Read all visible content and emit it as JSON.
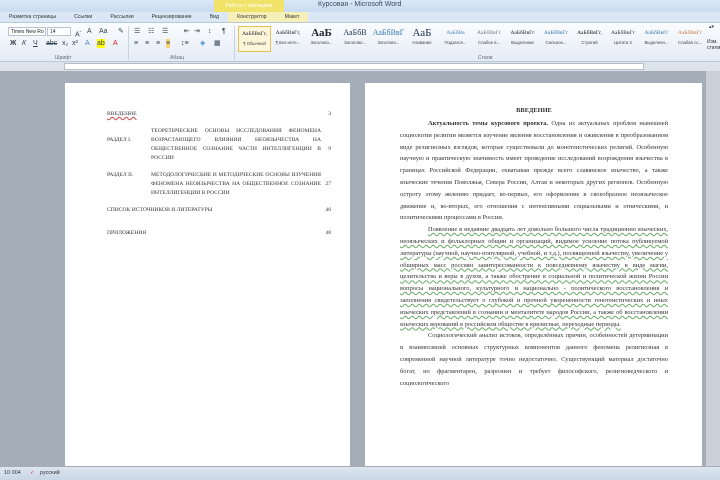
{
  "window": {
    "title": "Курсовая - Microsoft Word",
    "context_tab_group": "Работа с таблицами"
  },
  "tabs": [
    "Разметка страницы",
    "Ссылки",
    "Рассылки",
    "Рецензирование",
    "Вид",
    "Конструктор",
    "Макет"
  ],
  "ribbon": {
    "font": {
      "name": "Times New Ro",
      "size": "14",
      "group_label": "Шрифт"
    },
    "paragraph": {
      "group_label": "Абзац"
    },
    "styles": {
      "group_label": "Стили",
      "change_styles": "Изм. стили",
      "items": [
        {
          "preview": "АаБбВвГг,",
          "name": "¶ Обычный"
        },
        {
          "preview": "АаБбВвГг,",
          "name": "¶ Без инте..."
        },
        {
          "preview": "АаБ",
          "name": "Заголово..."
        },
        {
          "preview": "АаБбВ",
          "name": "Заголово..."
        },
        {
          "preview": "АаБбВвГ",
          "name": "Заголово..."
        },
        {
          "preview": "АаБ",
          "name": "Название"
        },
        {
          "preview": "АаБбВв",
          "name": "Подзагол..."
        },
        {
          "preview": "АаБбВвГг",
          "name": "Слабое в..."
        },
        {
          "preview": "АаБбВвГг",
          "name": "Выделение"
        },
        {
          "preview": "АаБбВвГг",
          "name": "Сильное..."
        },
        {
          "preview": "АаБбВвГг,",
          "name": "Строгий"
        },
        {
          "preview": "АаБбВвГг",
          "name": "Цитата 2"
        },
        {
          "preview": "АаБбВвГг",
          "name": "Выделенн..."
        },
        {
          "preview": "АаБбВвГг",
          "name": "Слабая сс..."
        }
      ]
    }
  },
  "toc": [
    {
      "label": "ВВЕДЕНИЕ",
      "title": "",
      "page": "3"
    },
    {
      "label": "РАЗДЕЛ I.",
      "title": "ТЕОРЕТИЧЕСКИЕ ОСНОВЫ ИССЛЕДОВАНИЯ ФЕНОМЕНА ВОЗРАСТАЮЩЕГО ВЛИЯНИЯ НЕОЯЗЫЧЕСТВА НА ОБЩЕСТВЕННОЕ СОЗНАНИЕ ЧАСТИ ИНТЕЛЛИГЕНЦИИ В РОССИИ",
      "page": "9"
    },
    {
      "label": "РАЗДЕЛ II.",
      "title": "МЕТОДОЛОГИЧЕСКИЕ И МЕТОДИЧЕСКИЕ ОСНОВЫ ИЗУЧЕНИЯ ФЕНОМЕНА НЕОЯЗЫЧЕСТВА НА ОБЩЕСТВЕННОЕ СОЗНАНИЕ ИНТЕЛЛИГЕНЦИИ В РОССИИ",
      "page": "27"
    },
    {
      "label": "СПИСОК ИСТОЧНИКОВ И ЛИТЕРАТУРЫ",
      "title": "",
      "page": "46"
    },
    {
      "label": "ПРИЛОЖЕНИЯ",
      "title": "",
      "page": "48"
    }
  ],
  "intro": {
    "heading": "ВВЕДЕНИЕ",
    "p1_bold": "Актуальность темы курсового проекта.",
    "p1": " Одна из актуальных проблем нынешней социологии религии является изучение явления восстановления и оживления в преобразованном виде религиозных взглядов, которые существовали до монотеистических религий. Особенную научную и практическую значимость имеет проведение исследований возрождения язычества в границах Российской Федерации, охватывая прежде всего славянское язычество, а также языческие течения Поволжья, Севера России, Алтая и некоторых других регионов. Особенную остроту этому явлению придает, во-первых, его оформление в своеобразное неоязыческое движение и, во-вторых, его отношения с интенсивными социальными и этническими, и политическими процессами в России.",
    "p2": "Появление в недавние двадцать лет довольно большого числа традиционно языческих, неоязыческих и фольклорных общин и организаций, видимое усиление потока публикуемой литературы (научной, научно-популярной, учебной, и т.д.), посвященной язычеству, увеличение у обширных масс россиян заинтересованности к повседневному язычеству в виде магии, целительства и веры в духов, а также обострение в социальной и политической жизни России вопросы национального, культурного и национально - политического восстановления и заполнения свидетельствует о глубокой и прочной укорененности генотеистических и иных языческих представлений в сознании и менталитете народов России, а также об восстановлении языческих верований в российском обществе в кризисные, переходные периоды.",
    "p3": "Социологический анализ истоков, определённых причин, особенностей детерминации и взаимосвязей основных структурных компонентов данного феномена религиозная в современной научной литературе точно недостаточно. Существующий материал достаточно богат, но фрагментарен, разрознен и требует философского, религиоведческого и социологического"
  },
  "status": {
    "words": "10 004",
    "language": "русский"
  }
}
